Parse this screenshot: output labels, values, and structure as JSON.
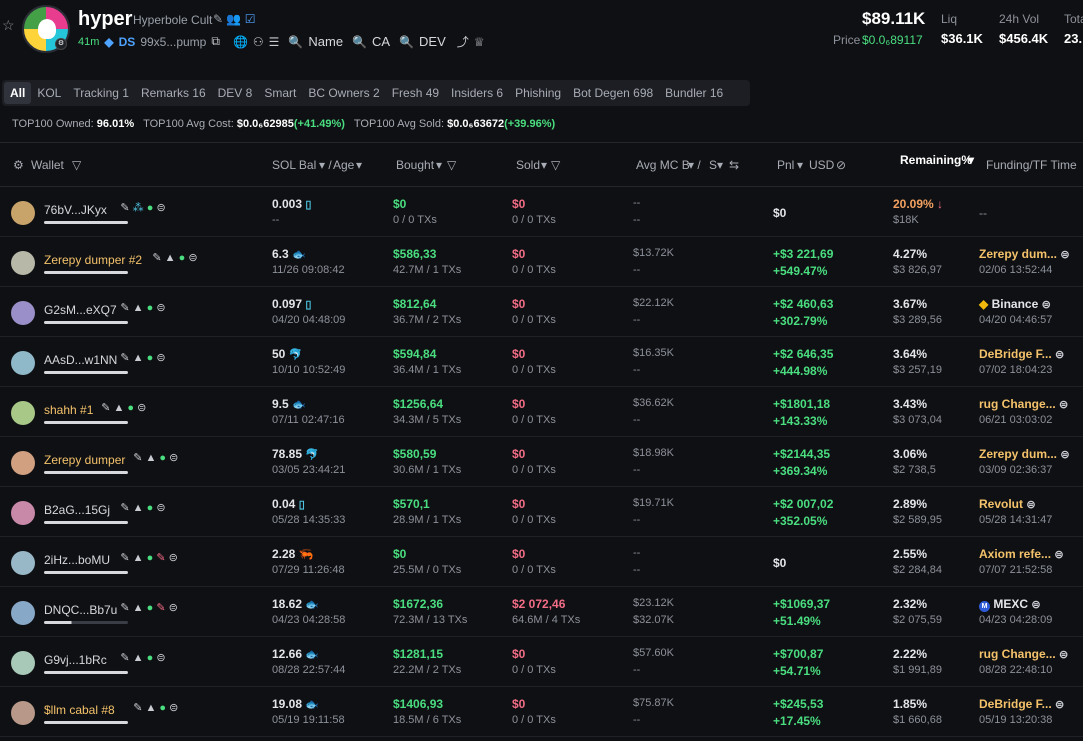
{
  "token": {
    "name": "hyper",
    "full_name": "Hyperbole Cult",
    "age": "41m",
    "ds_label": "DS",
    "contract": "99x5...pump",
    "links": [
      "Name",
      "CA",
      "DEV"
    ],
    "market_cap": "$89.11K",
    "price_label": "Price",
    "price_value": "$0.0₆89117"
  },
  "stats": [
    {
      "label": "Liq",
      "value": "$36.1K"
    },
    {
      "label": "24h Vol",
      "value": "$456.4K"
    },
    {
      "label": "Tota",
      "value": "23."
    }
  ],
  "tabs": [
    "All",
    "KOL",
    "Tracking 1",
    "Remarks 16",
    "DEV 8",
    "Smart",
    "BC Owners 2",
    "Fresh 49",
    "Insiders 6",
    "Phishing",
    "Bot Degen 698",
    "Bundler 16"
  ],
  "active_tab": "All",
  "summary": {
    "owned_label": "TOP100 Owned:",
    "owned_value": "96.01%",
    "cost_label": "TOP100 Avg Cost:",
    "cost_value": "$0.0₆62985",
    "cost_change": "(+41.49%)",
    "sold_label": "TOP100 Avg Sold:",
    "sold_value": "$0.0₆63672",
    "sold_change": "(+39.96%)"
  },
  "columns": {
    "wallet": "Wallet",
    "sol_bal": "SOL Bal",
    "age": "Age",
    "bought": "Bought",
    "sold": "Sold",
    "avg_mc": "Avg MC B",
    "avg_mc_s": "S",
    "pnl": "Pnl",
    "usd": "USD",
    "remaining": "Remaining%",
    "funding": "Funding/TF Time"
  },
  "rows": [
    {
      "wallet": "76bV...JKyx",
      "named": false,
      "sol": "0.003",
      "sol_icon": "▯",
      "age": "--",
      "bought": "$0",
      "bought_txs": "0 / 0 TXs",
      "sold": "$0",
      "sold_txs": "0 / 0 TXs",
      "mc_b": "--",
      "mc_s": "--",
      "pnl": "$0",
      "pnl_pct": "",
      "remaining": "20.09%",
      "remaining_usd": "$18K",
      "funding": "--",
      "funding_time": ""
    },
    {
      "wallet": "Zerepy dumper #2",
      "named": true,
      "sol": "6.3",
      "sol_icon": "🐟",
      "age": "11/26 09:08:42",
      "bought": "$586,33",
      "bought_txs": "42.7M / 1 TXs",
      "sold": "$0",
      "sold_txs": "0 / 0 TXs",
      "mc_b": "$13.72K",
      "mc_s": "--",
      "pnl": "+$3 221,69",
      "pnl_pct": "+549.47%",
      "remaining": "4.27%",
      "remaining_usd": "$3 826,97",
      "funding": "Zerepy dum...",
      "funding_time": "02/06 13:52:44"
    },
    {
      "wallet": "G2sM...eXQ7",
      "named": false,
      "sol": "0.097",
      "sol_icon": "▯",
      "age": "04/20 04:48:09",
      "bought": "$812,64",
      "bought_txs": "36.7M / 2 TXs",
      "sold": "$0",
      "sold_txs": "0 / 0 TXs",
      "mc_b": "$22.12K",
      "mc_s": "--",
      "pnl": "+$2 460,63",
      "pnl_pct": "+302.79%",
      "remaining": "3.67%",
      "remaining_usd": "$3 289,56",
      "funding": "Binance",
      "funding_time": "04/20 04:46:57"
    },
    {
      "wallet": "AAsD...w1NN",
      "named": false,
      "sol": "50",
      "sol_icon": "🐬",
      "age": "10/10 10:52:49",
      "bought": "$594,84",
      "bought_txs": "36.4M / 1 TXs",
      "sold": "$0",
      "sold_txs": "0 / 0 TXs",
      "mc_b": "$16.35K",
      "mc_s": "--",
      "pnl": "+$2 646,35",
      "pnl_pct": "+444.98%",
      "remaining": "3.64%",
      "remaining_usd": "$3 257,19",
      "funding": "DeBridge F...",
      "funding_time": "07/02 18:04:23"
    },
    {
      "wallet": "shahh #1",
      "named": true,
      "sol": "9.5",
      "sol_icon": "🐟",
      "age": "07/11 02:47:16",
      "bought": "$1256,64",
      "bought_txs": "34.3M / 5 TXs",
      "sold": "$0",
      "sold_txs": "0 / 0 TXs",
      "mc_b": "$36.62K",
      "mc_s": "--",
      "pnl": "+$1801,18",
      "pnl_pct": "+143.33%",
      "remaining": "3.43%",
      "remaining_usd": "$3 073,04",
      "funding": "rug Change...",
      "funding_time": "06/21 03:03:02"
    },
    {
      "wallet": "Zerepy dumper",
      "named": true,
      "sol": "78.85",
      "sol_icon": "🐬",
      "age": "03/05 23:44:21",
      "bought": "$580,59",
      "bought_txs": "30.6M / 1 TXs",
      "sold": "$0",
      "sold_txs": "0 / 0 TXs",
      "mc_b": "$18.98K",
      "mc_s": "--",
      "pnl": "+$2144,35",
      "pnl_pct": "+369.34%",
      "remaining": "3.06%",
      "remaining_usd": "$2 738,5",
      "funding": "Zerepy dum...",
      "funding_time": "03/09 02:36:37"
    },
    {
      "wallet": "B2aG...15Gj",
      "named": false,
      "sol": "0.04",
      "sol_icon": "▯",
      "age": "05/28 14:35:33",
      "bought": "$570,1",
      "bought_txs": "28.9M / 1 TXs",
      "sold": "$0",
      "sold_txs": "0 / 0 TXs",
      "mc_b": "$19.71K",
      "mc_s": "--",
      "pnl": "+$2 007,02",
      "pnl_pct": "+352.05%",
      "remaining": "2.89%",
      "remaining_usd": "$2 589,95",
      "funding": "Revolut",
      "funding_time": "05/28 14:31:47"
    },
    {
      "wallet": "2iHz...boMU",
      "named": false,
      "sol": "2.28",
      "sol_icon": "🦐",
      "age": "07/29 11:26:48",
      "bought": "$0",
      "bought_txs": "25.5M / 0 TXs",
      "sold": "$0",
      "sold_txs": "0 / 0 TXs",
      "mc_b": "--",
      "mc_s": "--",
      "pnl": "$0",
      "pnl_pct": "",
      "remaining": "2.55%",
      "remaining_usd": "$2 284,84",
      "funding": "Axiom refe...",
      "funding_time": "07/07 21:52:58"
    },
    {
      "wallet": "DNQC...Bb7u",
      "named": false,
      "sol": "18.62",
      "sol_icon": "🐟",
      "age": "04/23 04:28:58",
      "bought": "$1672,36",
      "bought_txs": "72.3M / 13 TXs",
      "sold": "$2 072,46",
      "sold_txs": "64.6M / 4 TXs",
      "mc_b": "$23.12K",
      "mc_s": "$32.07K",
      "pnl": "+$1069,37",
      "pnl_pct": "+51.49%",
      "remaining": "2.32%",
      "remaining_usd": "$2 075,59",
      "funding": "MEXC",
      "funding_time": "04/23 04:28:09"
    },
    {
      "wallet": "G9vj...1bRc",
      "named": false,
      "sol": "12.66",
      "sol_icon": "🐟",
      "age": "08/28 22:57:44",
      "bought": "$1281,15",
      "bought_txs": "22.2M / 2 TXs",
      "sold": "$0",
      "sold_txs": "0 / 0 TXs",
      "mc_b": "$57.60K",
      "mc_s": "--",
      "pnl": "+$700,87",
      "pnl_pct": "+54.71%",
      "remaining": "2.22%",
      "remaining_usd": "$1 991,89",
      "funding": "rug Change...",
      "funding_time": "08/28 22:48:10"
    },
    {
      "wallet": "$llm cabal #8",
      "named": true,
      "sol": "19.08",
      "sol_icon": "🐟",
      "age": "05/19 19:11:58",
      "bought": "$1406,93",
      "bought_txs": "18.5M / 6 TXs",
      "sold": "$0",
      "sold_txs": "0 / 0 TXs",
      "mc_b": "$75.87K",
      "mc_s": "--",
      "pnl": "+$245,53",
      "pnl_pct": "+17.45%",
      "remaining": "1.85%",
      "remaining_usd": "$1 660,68",
      "funding": "DeBridge F...",
      "funding_time": "05/19 13:20:38"
    }
  ]
}
